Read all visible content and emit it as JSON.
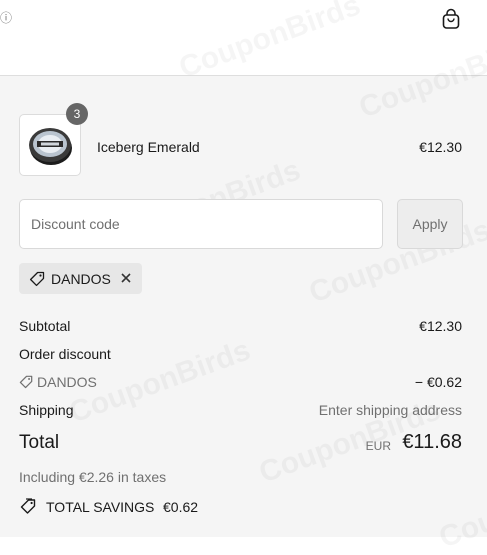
{
  "header": {
    "info_glyph": "ⓘ",
    "info_icon": "info-icon",
    "cart_icon": "shopping-bag-icon"
  },
  "watermark": "CouponBirds",
  "product": {
    "image_icon": "product-tin-image",
    "quantity": "3",
    "name": "Iceberg Emerald",
    "price": "€12.30"
  },
  "discount": {
    "placeholder": "Discount code",
    "value": "",
    "apply_label": "Apply",
    "applied_code": "DANDOS",
    "tag_icon": "tag-icon",
    "remove_icon": "close-icon"
  },
  "summary": {
    "subtotal_label": "Subtotal",
    "subtotal_value": "€12.30",
    "order_discount_label": "Order discount",
    "discount_code": "DANDOS",
    "discount_value": "− €0.62",
    "shipping_label": "Shipping",
    "shipping_value": "Enter shipping address",
    "total_label": "Total",
    "currency": "EUR",
    "total_value": "€11.68",
    "taxes_note": "Including €2.26 in taxes",
    "savings_label": "TOTAL SAVINGS",
    "savings_value": "€0.62",
    "savings_icon": "tags-icon"
  },
  "colors": {
    "background": "#f5f5f5",
    "header_background": "#ffffff",
    "muted_text": "#707070",
    "chip_background": "#e7e7e7",
    "badge_background": "#666666"
  }
}
